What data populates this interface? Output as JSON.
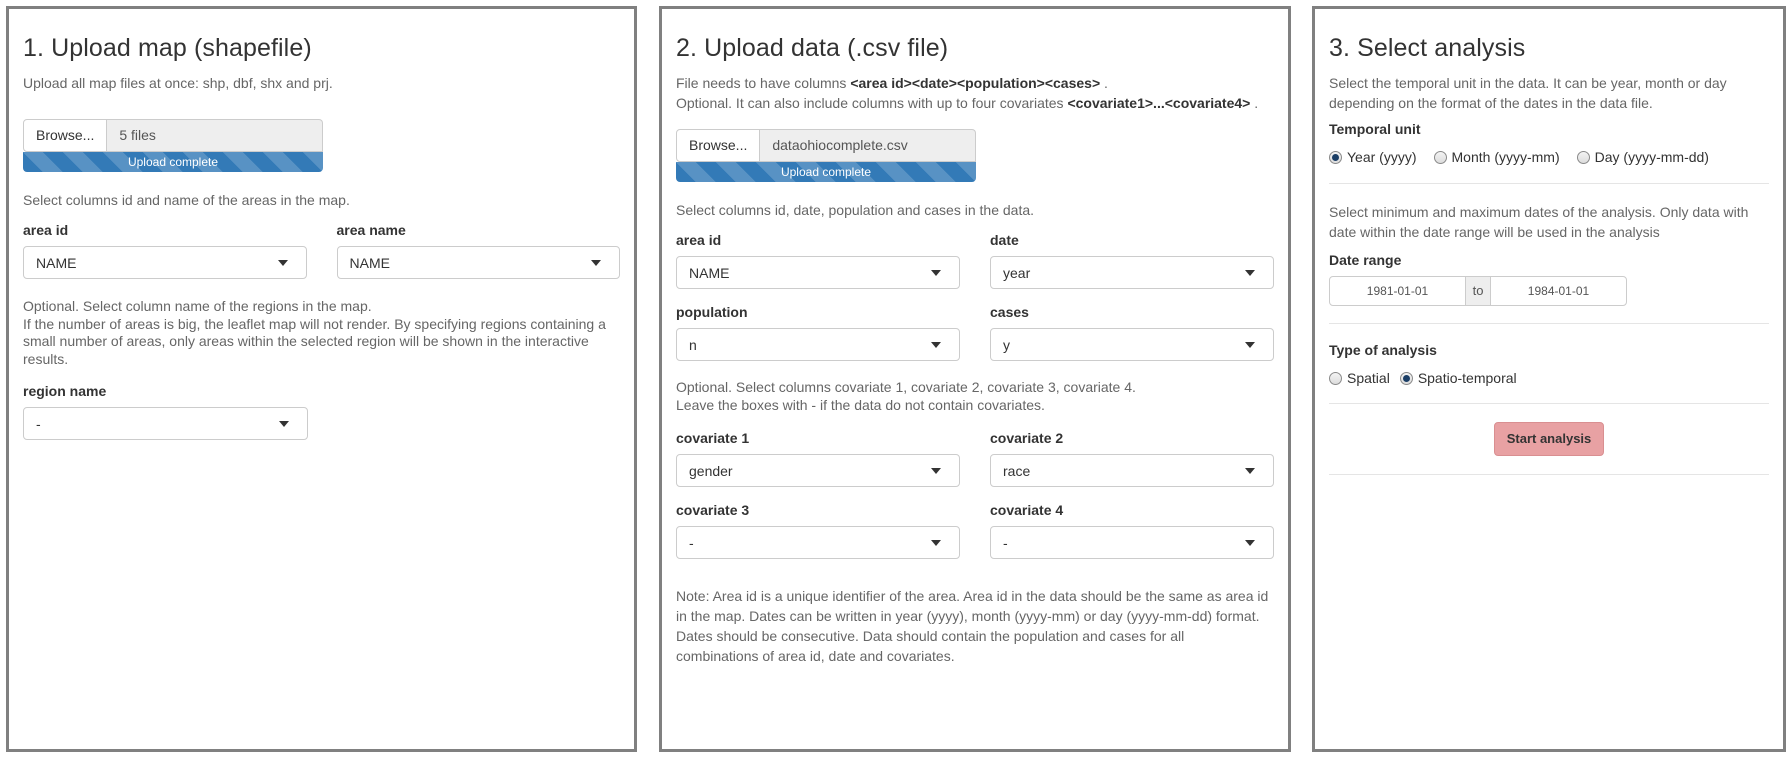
{
  "panel1": {
    "title": "1. Upload map (shapefile)",
    "help": "Upload all map files at once: shp, dbf, shx and prj.",
    "browse_label": "Browse...",
    "file_text": "5 files",
    "progress_text": "Upload complete",
    "select_help": "Select columns id and name of the areas in the map.",
    "area_id_label": "area id",
    "area_id_value": "NAME",
    "area_name_label": "area name",
    "area_name_value": "NAME",
    "optional_line1": "Optional. Select column name of the regions in the map.",
    "optional_line2": "If the number of areas is big, the leaflet map will not render. By specifying regions containing a small number of areas, only areas within the selected region will be shown in the interactive results.",
    "region_label": "region name",
    "region_value": "-"
  },
  "panel2": {
    "title": "2. Upload data (.csv file)",
    "help1_prefix": "File needs to have columns ",
    "help1_bold": "<area id><date><population><cases>",
    "help1_suffix": " .",
    "help2_prefix": "Optional. It can also include columns with up to four covariates ",
    "help2_bold": "<covariate1>...<covariate4>",
    "help2_suffix": " .",
    "browse_label": "Browse...",
    "file_text": "dataohiocomplete.csv",
    "progress_text": "Upload complete",
    "select_help": "Select columns id, date, population and cases in the data.",
    "area_id_label": "area id",
    "area_id_value": "NAME",
    "date_label": "date",
    "date_value": "year",
    "population_label": "population",
    "population_value": "n",
    "cases_label": "cases",
    "cases_value": "y",
    "optional_line1": "Optional. Select columns covariate 1, covariate 2, covariate 3, covariate 4.",
    "optional_line2": "Leave the boxes with - if the data do not contain covariates.",
    "cov1_label": "covariate 1",
    "cov1_value": "gender",
    "cov2_label": "covariate 2",
    "cov2_value": "race",
    "cov3_label": "covariate 3",
    "cov3_value": "-",
    "cov4_label": "covariate 4",
    "cov4_value": "-",
    "note": "Note: Area id is a unique identifier of the area. Area id in the data should be the same as area id in the map. Dates can be written in year (yyyy), month (yyyy-mm) or day (yyyy-mm-dd) format. Dates should be consecutive. Data should contain the population and cases for all combinations of area id, date and covariates."
  },
  "panel3": {
    "title": "3. Select analysis",
    "help": "Select the temporal unit in the data. It can be year, month or day depending on the format of the dates in the data file.",
    "temporal_label": "Temporal unit",
    "temporal_options": [
      "Year (yyyy)",
      "Month (yyyy-mm)",
      "Day (yyyy-mm-dd)"
    ],
    "temporal_selected": "Year (yyyy)",
    "date_help": "Select minimum and maximum dates of the analysis. Only data with date within the date range will be used in the analysis",
    "date_range_label": "Date range",
    "date_start": "1981-01-01",
    "date_to": "to",
    "date_end": "1984-01-01",
    "analysis_label": "Type of analysis",
    "analysis_options": [
      "Spatial",
      "Spatio-temporal"
    ],
    "analysis_selected": "Spatio-temporal",
    "start_button": "Start analysis"
  }
}
